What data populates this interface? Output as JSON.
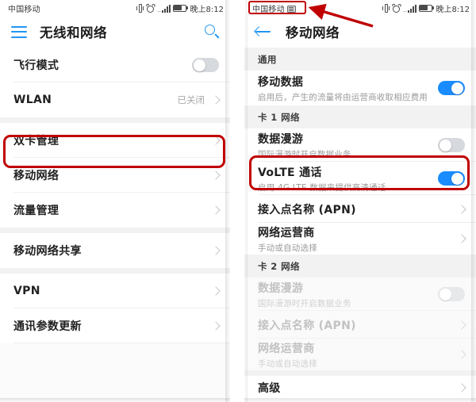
{
  "meta": {
    "accent_blue": "#1a8cff",
    "icon_blue": "#2196f3",
    "highlight_red": "#c00000",
    "section_bg": "#f2f2f2"
  },
  "left_screen": {
    "status_bar": {
      "carrier": "中国移动",
      "time": "晚上8:12",
      "icons": [
        "vibrate-icon",
        "alarm-icon",
        "signal-icon",
        "battery-icon"
      ]
    },
    "app_bar": {
      "menu_icon": "hamburger-icon",
      "title": "无线和网络",
      "search_icon": "search-icon"
    },
    "groups": [
      {
        "rows": [
          {
            "title": "飞行模式",
            "control": "toggle",
            "toggle_on": false
          },
          {
            "title": "WLAN",
            "value": "已关闭",
            "control": "chevron"
          }
        ]
      },
      {
        "rows": [
          {
            "title": "双卡管理",
            "control": "chevron"
          },
          {
            "title": "移动网络",
            "control": "chevron",
            "highlighted": true
          },
          {
            "title": "流量管理",
            "control": "chevron"
          }
        ]
      },
      {
        "rows": [
          {
            "title": "移动网络共享",
            "control": "chevron"
          }
        ]
      },
      {
        "rows": [
          {
            "title": "VPN",
            "control": "chevron"
          },
          {
            "title": "通讯参数更新",
            "control": "chevron"
          }
        ]
      }
    ]
  },
  "right_screen": {
    "status_bar": {
      "carrier": "中国移动",
      "carrier_badge": "volte-badge-icon",
      "time": "晚上8:12",
      "icons": [
        "vibrate-icon",
        "alarm-icon",
        "signal-icon",
        "battery-icon"
      ]
    },
    "app_bar": {
      "back_icon": "back-arrow-icon",
      "title": "移动网络"
    },
    "sections": [
      {
        "header": "通用",
        "disabled": false,
        "rows": [
          {
            "title": "移动数据",
            "sub": "启用后，产生的流量将由运营商收取相应费用",
            "control": "toggle",
            "toggle_on": true
          }
        ]
      },
      {
        "header": "卡 1 网络",
        "disabled": false,
        "rows": [
          {
            "title": "数据漫游",
            "sub": "国际漫游时开启数据业务",
            "control": "toggle",
            "toggle_on": false
          },
          {
            "title": "VoLTE 通话",
            "sub": "启用 4G LTE 数据来提供高清通话",
            "control": "toggle",
            "toggle_on": true,
            "highlighted": true
          },
          {
            "title": "接入点名称 (APN)",
            "control": "chevron"
          },
          {
            "title": "网络运营商",
            "sub": "手动或自动选择",
            "control": "chevron"
          }
        ]
      },
      {
        "header": "卡 2 网络",
        "disabled": true,
        "rows": [
          {
            "title": "数据漫游",
            "sub": "国际漫游时开启数据业务",
            "control": "toggle",
            "toggle_on": false
          },
          {
            "title": "接入点名称 (APN)",
            "control": "chevron"
          },
          {
            "title": "网络运营商",
            "sub": "手动或自动选择",
            "control": "chevron"
          }
        ]
      },
      {
        "header": "",
        "disabled": false,
        "rows": [
          {
            "title": "高级",
            "control": "chevron"
          }
        ]
      }
    ]
  },
  "annotations": {
    "left_box_label": "移动网络",
    "right_box_label": "VoLTE 通话",
    "badge_box_label": "中国移动 VoLTE",
    "arrow_label": "pointer-arrow"
  }
}
